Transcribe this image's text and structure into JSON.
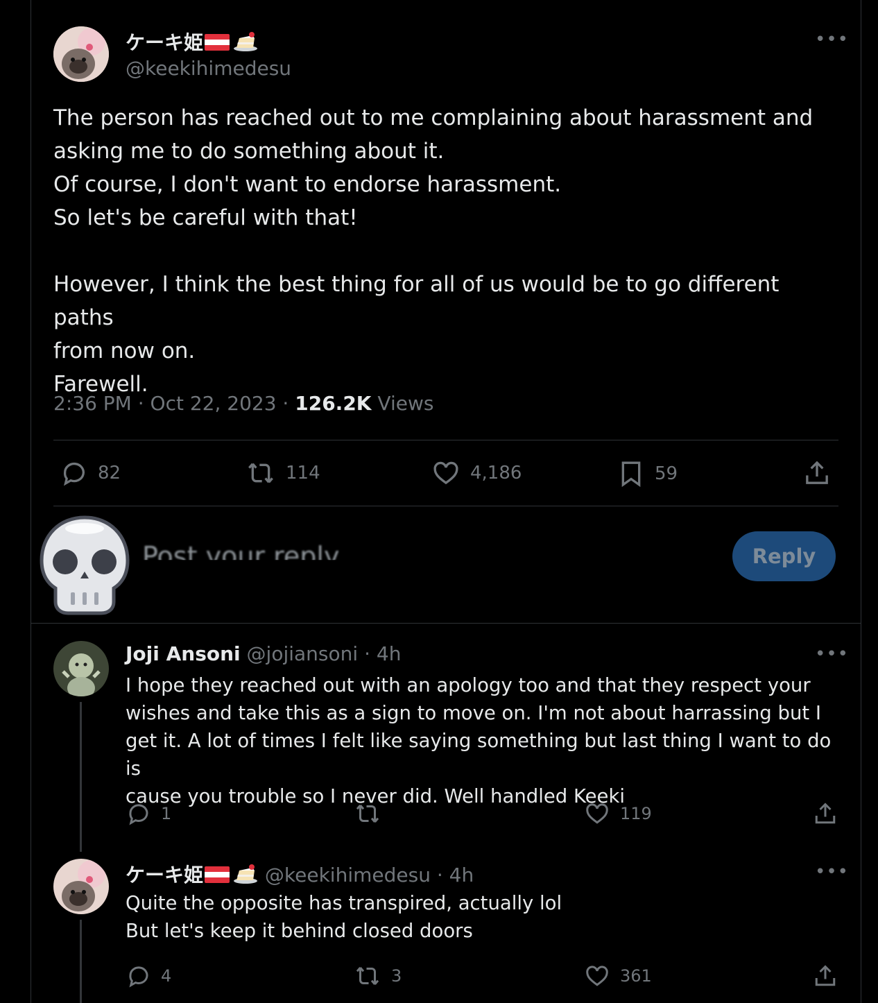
{
  "main_tweet": {
    "display_name": "ケーキ姫",
    "handle": "@keekihimedesu",
    "lines": [
      "The person has reached out to me complaining about harassment and",
      "asking me to do something about it.",
      "Of course, I don't want to endorse harassment.",
      "So let's be careful with that!",
      "",
      "However, I think the best thing for all of us would be to go different paths",
      "from now on.",
      "Farewell."
    ],
    "time": "2:36 PM",
    "date": "Oct 22, 2023",
    "views_count": "126.2K",
    "views_label": "Views",
    "stats": {
      "replies": "82",
      "reposts": "114",
      "likes": "4,186",
      "bookmarks": "59"
    }
  },
  "composer": {
    "placeholder": "Post your reply",
    "reply_button": "Reply",
    "overlay_emoji": "skull-emoji"
  },
  "replies": [
    {
      "display_name": "Joji Ansoni",
      "handle": "@jojiansoni",
      "time": "4h",
      "lines": [
        "I hope they reached out with an apology too and that they respect your",
        "wishes and take this as a sign to move on. I'm not about harrassing but I",
        "get it. A lot of times I felt like saying something but last thing I want to do is",
        "cause you trouble so I never did. Well handled Keeki"
      ],
      "replies": "1",
      "reposts": "",
      "likes": "119"
    },
    {
      "display_name": "ケーキ姫",
      "handle": "@keekihimedesu",
      "time": "4h",
      "lines": [
        "Quite the opposite has transpired, actually lol",
        "But let's keep it behind closed doors"
      ],
      "replies": "4",
      "reposts": "3",
      "likes": "361"
    }
  ],
  "colors": {
    "background": "#000000",
    "text": "#e7e9ea",
    "muted": "#71767b",
    "border": "#2f3336",
    "reply_button_bg": "#1d4a7a"
  }
}
